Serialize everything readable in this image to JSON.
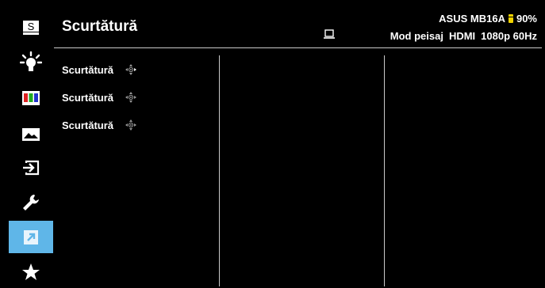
{
  "sidebar": {
    "items": [
      {
        "name": "splendid-icon"
      },
      {
        "name": "blue-light-filter-icon"
      },
      {
        "name": "color-icon"
      },
      {
        "name": "image-icon"
      },
      {
        "name": "input-select-icon"
      },
      {
        "name": "system-setup-icon"
      },
      {
        "name": "shortcut-icon",
        "active": true
      },
      {
        "name": "myfavorite-icon"
      }
    ],
    "splendid_letter": "S",
    "active_color": "#5fb6e8"
  },
  "header": {
    "title": "Scurtătură",
    "model": "ASUS MB16A",
    "battery": "90%",
    "battery_color": "#f2d300",
    "mode": "Mod peisaj",
    "input": "HDMI",
    "resolution": "1080p 60Hz"
  },
  "menu": {
    "items": [
      {
        "label": "Scurtătură"
      },
      {
        "label": "Scurtătură"
      },
      {
        "label": "Scurtătură"
      }
    ]
  }
}
